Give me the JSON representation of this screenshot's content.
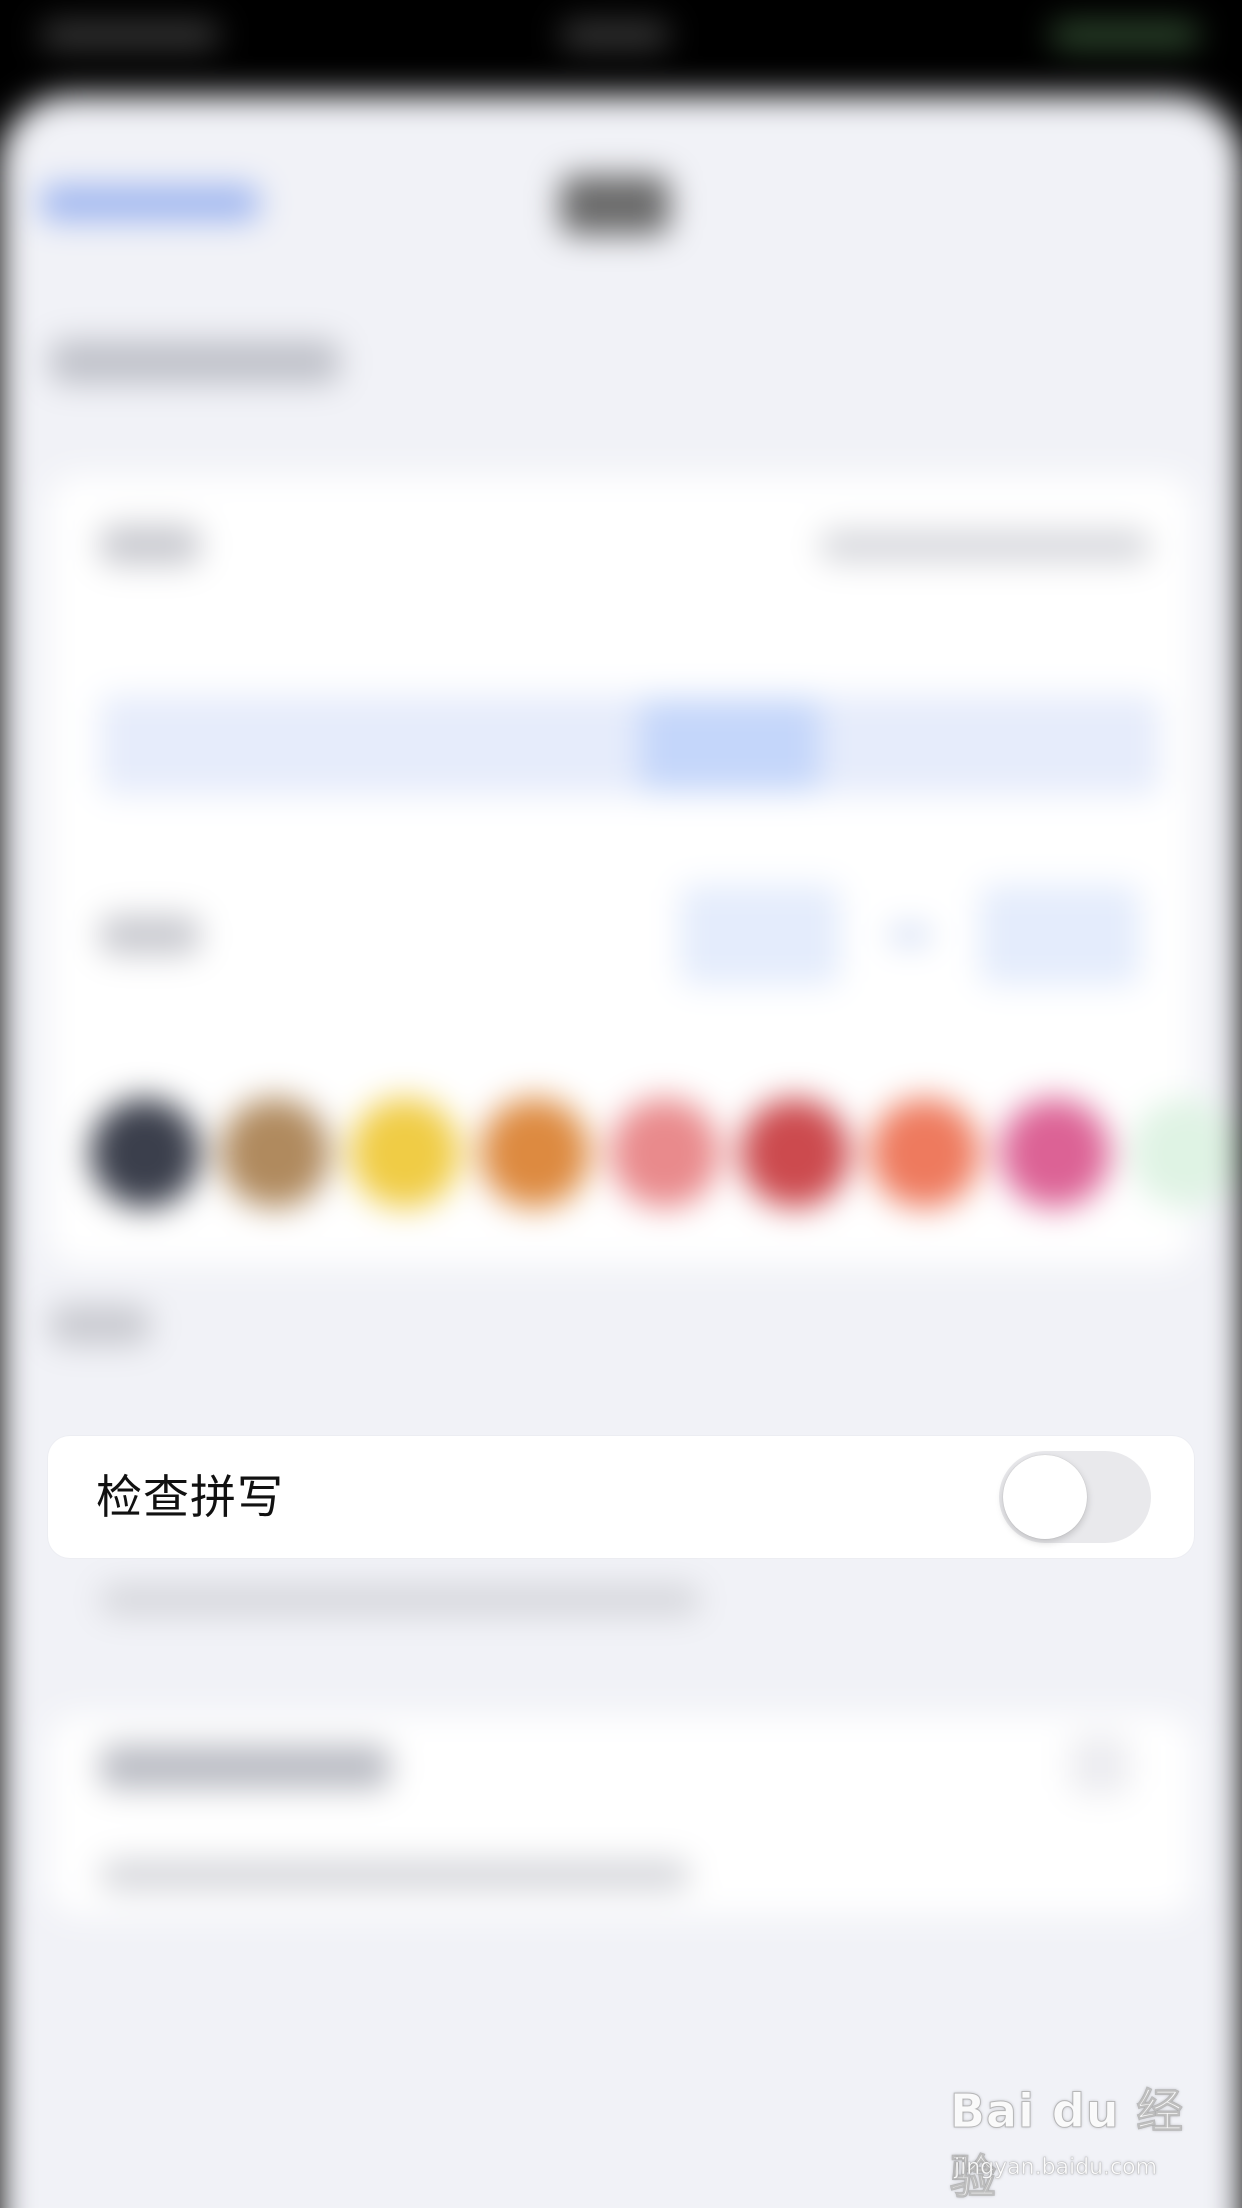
{
  "spell_check": {
    "label": "检查拼写",
    "enabled": false
  },
  "colors": {
    "background_sheet": "#f1f2f7",
    "card": "#ffffff",
    "toggle_off": "#e9e9ec",
    "swatches": [
      "#3b3f4c",
      "#b08a5e",
      "#f0cc45",
      "#dd8a40",
      "#e98a8c",
      "#cc4a4e",
      "#ee7a5e",
      "#dc6295",
      "#dff3e4"
    ]
  },
  "watermark": {
    "logo": "Bai du 经验",
    "url": "jingyan.baidu.com"
  }
}
